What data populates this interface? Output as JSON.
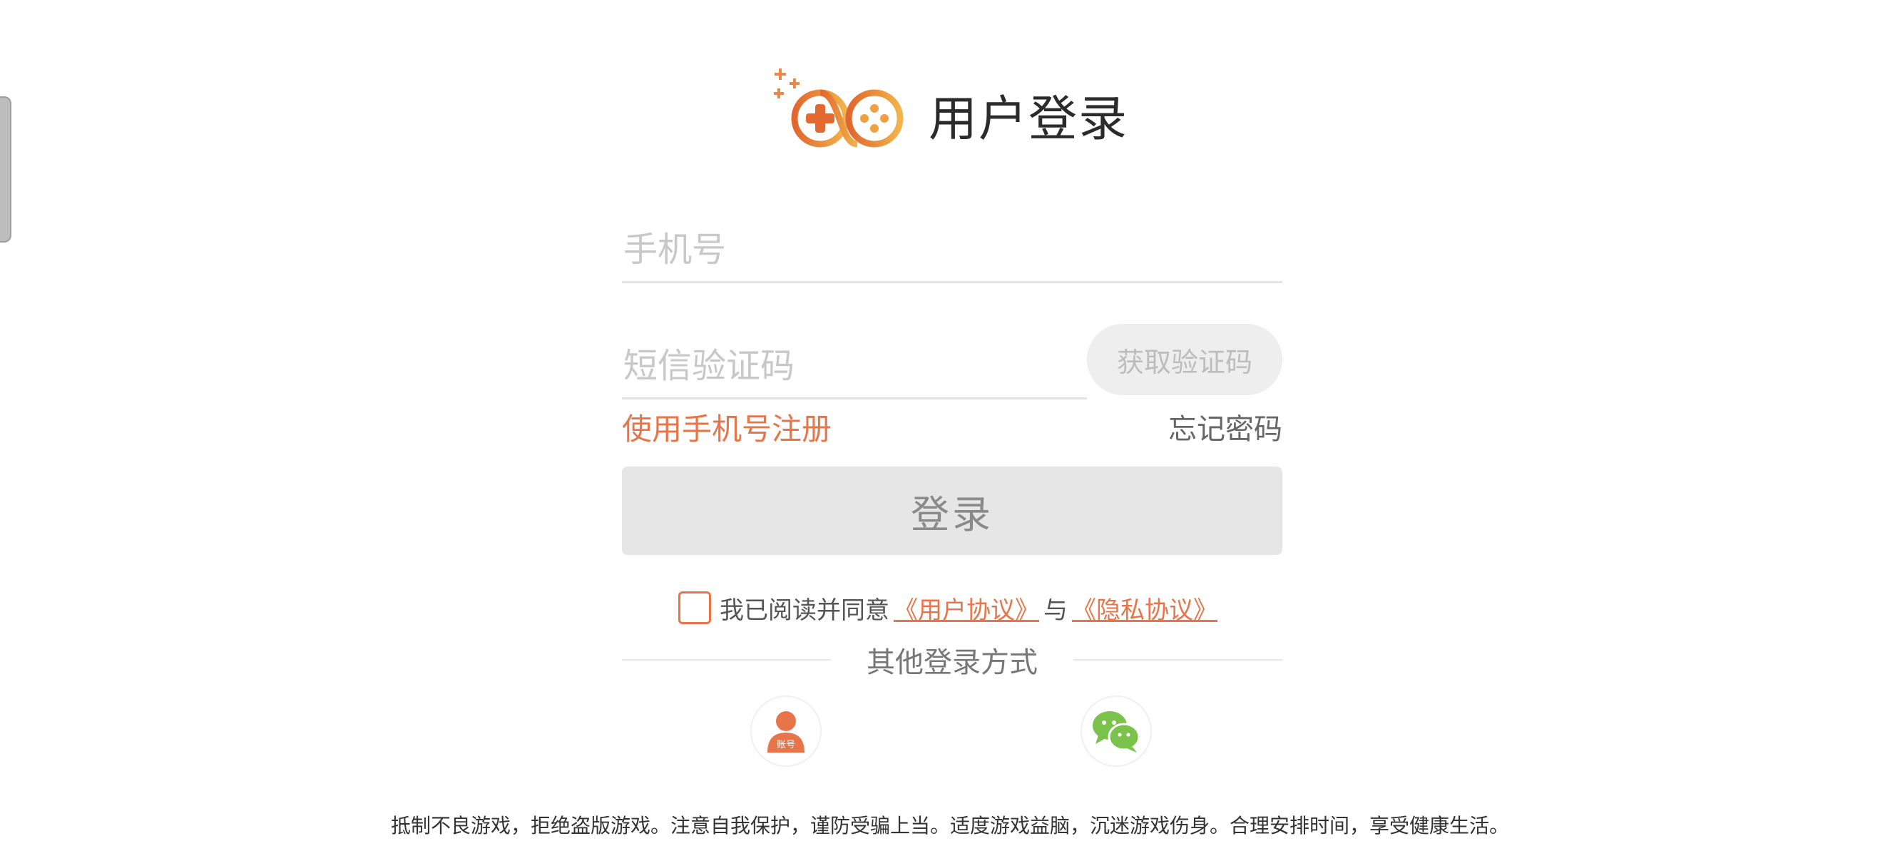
{
  "header": {
    "title": "用户登录",
    "logo_icon": "gamepad-logo-icon"
  },
  "form": {
    "phone_placeholder": "手机号",
    "sms_placeholder": "短信验证码",
    "get_code_label": "获取验证码",
    "register_label": "使用手机号注册",
    "forgot_label": "忘记密码",
    "login_label": "登录"
  },
  "agreement": {
    "text": "我已阅读并同意",
    "user_agreement": "《用户协议》",
    "conjunction": "与",
    "privacy_agreement": "《隐私协议》"
  },
  "other_login": {
    "label": "其他登录方式",
    "account_badge": "账号",
    "account_icon": "account-login-icon",
    "wechat_icon": "wechat-icon"
  },
  "footer": {
    "notice": "抵制不良游戏，拒绝盗版游戏。注意自我保护，谨防受骗上当。适度游戏益脑，沉迷游戏伤身。合理安排时间，享受健康生活。"
  },
  "colors": {
    "accent": "#e8754a",
    "wechat": "#7bc24b",
    "disabled": "#e6e6e6"
  }
}
